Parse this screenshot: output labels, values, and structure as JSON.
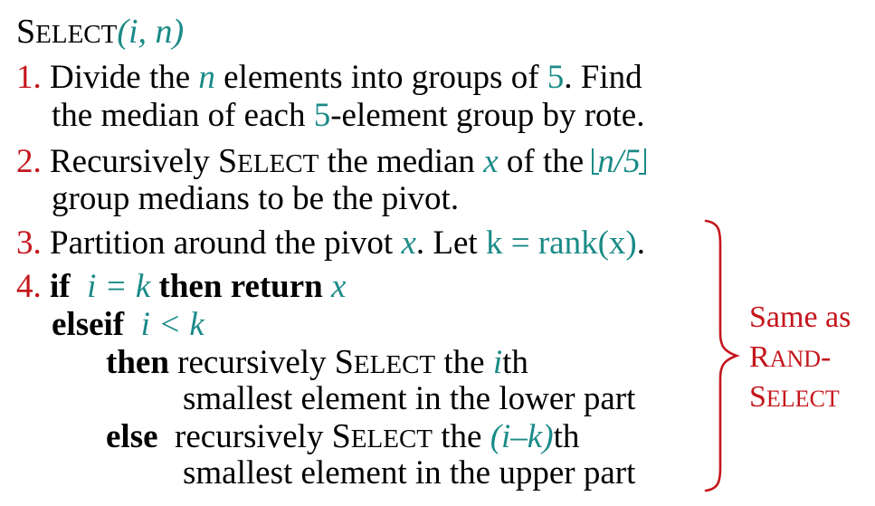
{
  "colors": {
    "accent": "#1a8a87",
    "step_number": "#c4161c",
    "note": "#c4161c"
  },
  "title": {
    "select_first": "S",
    "select_rest": "ELECT",
    "args": "(i, n)"
  },
  "step1": {
    "num": "1.",
    "t1": "Divide the ",
    "n": "n",
    "t2": " elements into groups of ",
    "five": "5",
    "t3": ".  Find",
    "l2a": "the median of each ",
    "five2": "5",
    "l2b": "-element group by rote."
  },
  "step2": {
    "num": "2.",
    "t1": "Recursively ",
    "sel_first": "S",
    "sel_rest": "ELECT",
    "t2": " the median ",
    "x": "x",
    "t3": " of the ",
    "floor": "n/5",
    "l2": "group medians to be the pivot."
  },
  "step3": {
    "num": "3.",
    "t1": "Partition around the pivot ",
    "x": "x",
    "t2": ".  Let ",
    "expr": "k = rank(x)",
    "t3": "."
  },
  "step4": {
    "num": "4.",
    "if": "if",
    "cond1": "i = k",
    "then": "then",
    "return": "return",
    "x": "x",
    "elseif": "elseif",
    "cond2": "i < k",
    "then2": "then",
    "then_text1": " recursively ",
    "sel_first": "S",
    "sel_rest": "ELECT",
    "then_text2": " the ",
    "i": "i",
    "then_text3": "th",
    "then_line2": "smallest element in the lower part",
    "else": "else",
    "else_text1": "  recursively ",
    "else_sel_first": "S",
    "else_sel_rest": "ELECT",
    "else_text2": " the ",
    "ik": "(i–k)",
    "else_text3": "th",
    "else_line2": "smallest element in the upper part"
  },
  "note": {
    "line1": "Same as",
    "rand_first": "R",
    "rand_rest": "AND",
    "dash": "-",
    "select_first": "S",
    "select_rest": "ELECT"
  }
}
